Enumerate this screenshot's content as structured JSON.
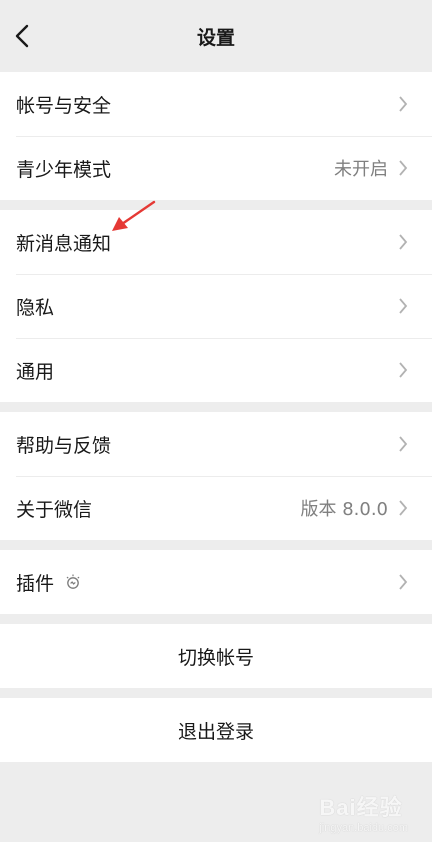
{
  "nav": {
    "title": "设置"
  },
  "groups": [
    {
      "items": [
        {
          "label": "帐号与安全",
          "value": ""
        },
        {
          "label": "青少年模式",
          "value": "未开启"
        }
      ]
    },
    {
      "items": [
        {
          "label": "新消息通知",
          "value": ""
        },
        {
          "label": "隐私",
          "value": ""
        },
        {
          "label": "通用",
          "value": ""
        }
      ]
    },
    {
      "items": [
        {
          "label": "帮助与反馈",
          "value": ""
        },
        {
          "label": "关于微信",
          "value": "版本 8.0.0"
        }
      ]
    },
    {
      "items": [
        {
          "label": "插件",
          "value": ""
        }
      ]
    }
  ],
  "actions": {
    "switch_account": "切换帐号",
    "logout": "退出登录"
  },
  "icons": {
    "back": "chevron-left-icon",
    "chevron": "chevron-right-icon",
    "plugin": "plugin-bulb-icon",
    "annotation": "red-arrow-annotation"
  },
  "colors": {
    "background": "#ededed",
    "card": "#ffffff",
    "text": "#191919",
    "secondary_text": "#808080",
    "annotation": "#e53935"
  },
  "watermark": {
    "brand": "Bai经验",
    "sub": "jingyan.baidu.com"
  }
}
